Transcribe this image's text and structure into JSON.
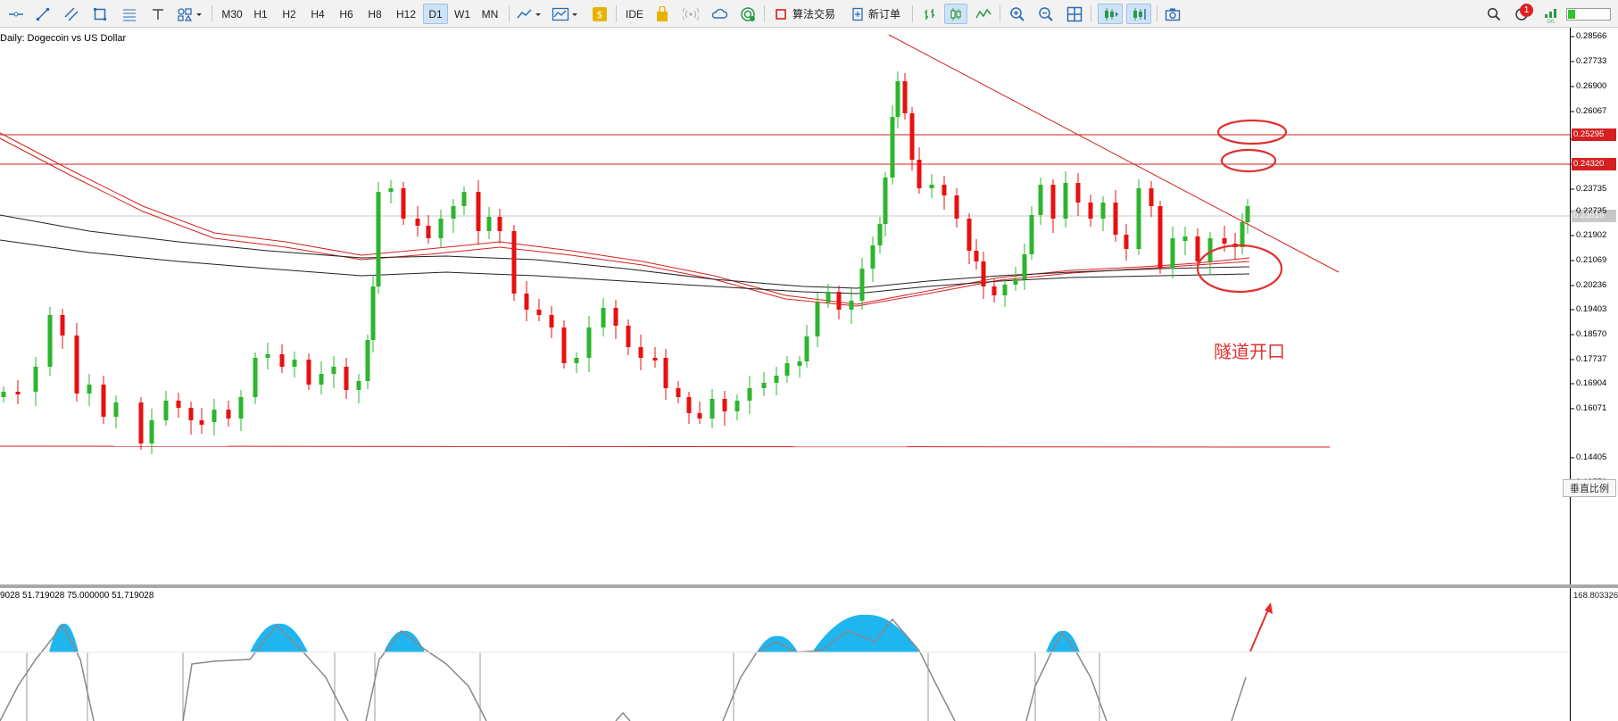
{
  "toolbar": {
    "timeframes": [
      "M30",
      "H1",
      "H2",
      "H4",
      "H6",
      "H8",
      "H12",
      "D1",
      "W1",
      "MN"
    ],
    "active_timeframe": "D1",
    "ide_label": "IDE",
    "algo_trading_label": "算法交易",
    "new_order_label": "新订单",
    "notification_count": "1"
  },
  "chart": {
    "title": "Daily:  Dogecoin vs US Dollar",
    "annotation_text": "隧道开口",
    "scale_button_label": "垂直比例"
  },
  "price_axis": {
    "labels": [
      "0.28566",
      "0.27733",
      "0.26900",
      "0.26067",
      "0.25295",
      "0.24320",
      "0.23735",
      "0.22735",
      "0.21902",
      "0.21069",
      "0.20236",
      "0.19403",
      "0.18570",
      "0.17737",
      "0.16904",
      "0.16071",
      "0.14405",
      "0.13572"
    ],
    "red_levels": [
      "0.25295",
      "0.24320"
    ],
    "current_price": "0.23519"
  },
  "indicator": {
    "title": "9028 51.719028 75.000000 51.719028",
    "axis_top_label": "168.803326"
  },
  "colors": {
    "bull": "#2db52d",
    "bear": "#e81010",
    "line_red": "#d42020",
    "ma_dark": "#222222",
    "osc_fill": "#1fb6f0",
    "osc_line": "#888888"
  }
}
